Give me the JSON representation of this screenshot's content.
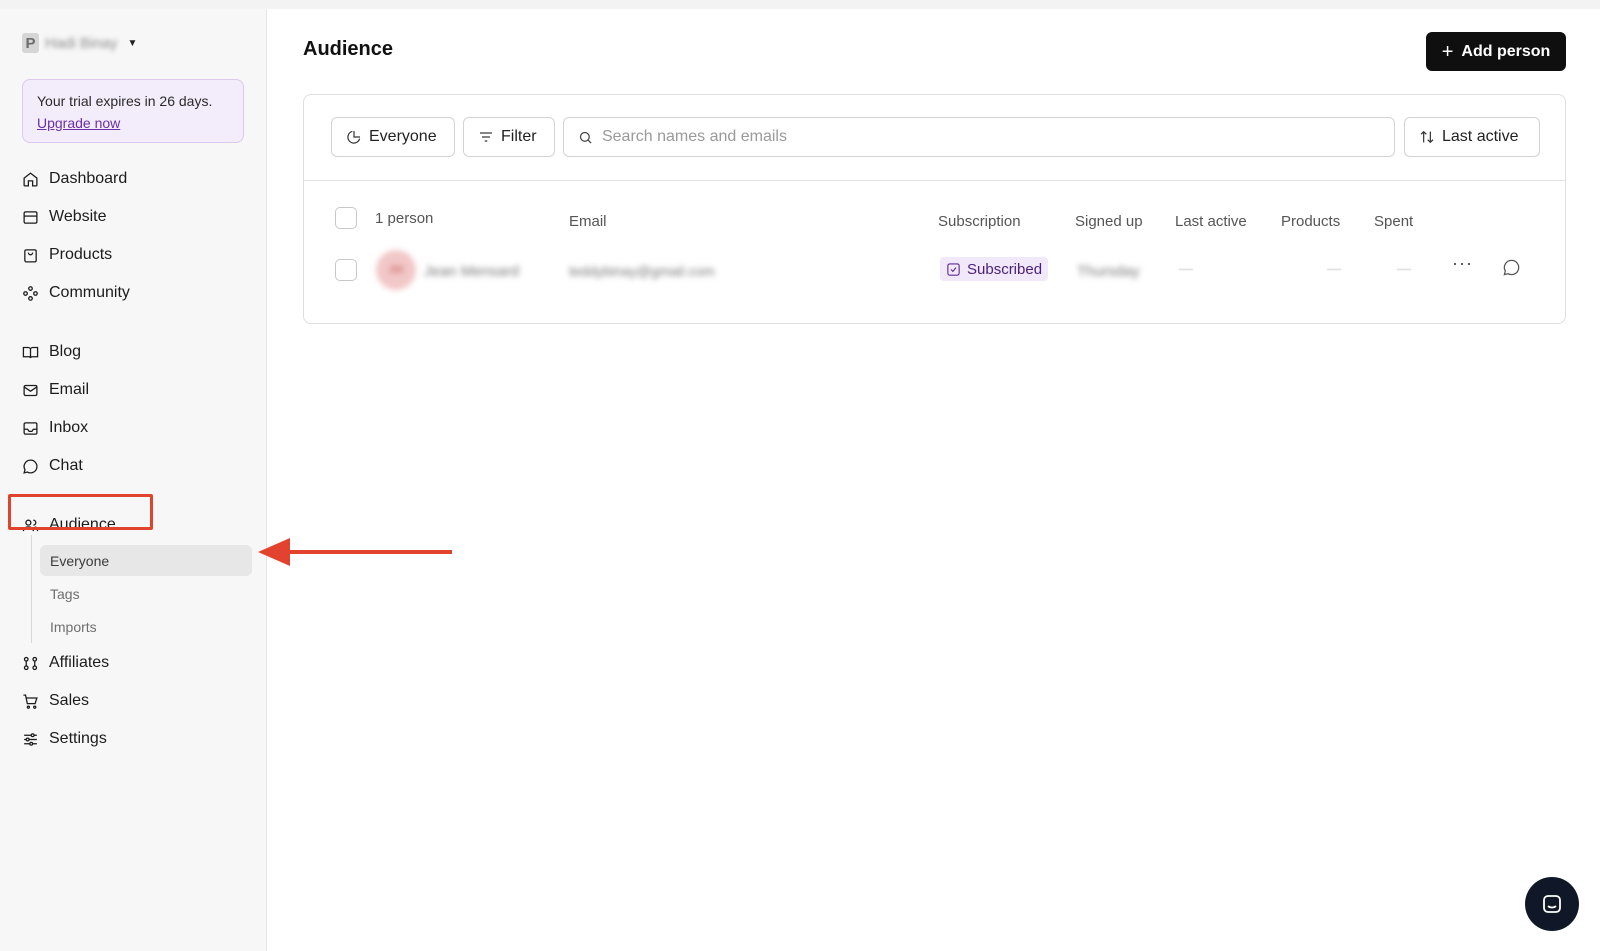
{
  "workspace": {
    "initial": "P",
    "name": "Hadi Binay"
  },
  "trial": {
    "message": "Your trial expires in 26 days.",
    "upgrade_label": "Upgrade now"
  },
  "nav": {
    "dashboard": "Dashboard",
    "website": "Website",
    "products": "Products",
    "community": "Community",
    "blog": "Blog",
    "email": "Email",
    "inbox": "Inbox",
    "chat": "Chat",
    "audience": "Audience",
    "audience_sub": [
      "Everyone",
      "Tags",
      "Imports"
    ],
    "affiliates": "Affiliates",
    "sales": "Sales",
    "settings": "Settings"
  },
  "page": {
    "title": "Audience",
    "add_button": "Add person"
  },
  "toolbar": {
    "segment_label": "Everyone",
    "filter_label": "Filter",
    "search_placeholder": "Search names and emails",
    "sort_label": "Last active"
  },
  "table": {
    "count_label": "1 person",
    "columns": {
      "email": "Email",
      "subscription": "Subscription",
      "signed_up": "Signed up",
      "last_active": "Last active",
      "products": "Products",
      "spent": "Spent"
    },
    "rows": [
      {
        "initials": "JM",
        "name": "Jean Mensard",
        "email": "teddybinay@gmail.com",
        "subscription": "Subscribed",
        "signed_up": "Thursday",
        "last_active": "—",
        "products": "—",
        "spent": "—",
        "more": "···"
      }
    ]
  },
  "colors": {
    "accent": "#6b2fa6",
    "annotation": "#e2432f",
    "button_dark": "#0f0f0f"
  }
}
